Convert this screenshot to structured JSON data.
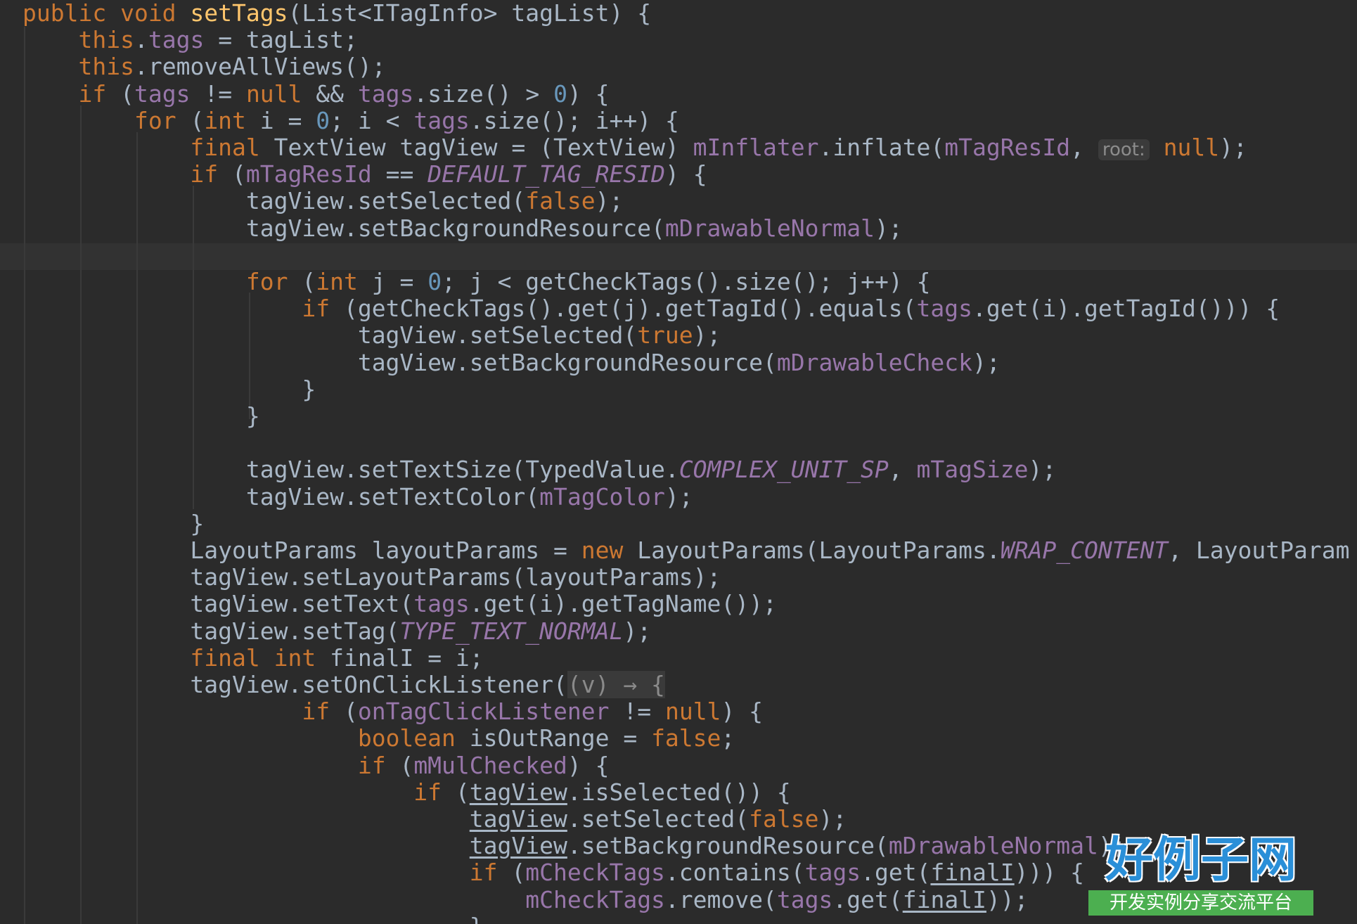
{
  "editor": {
    "lines": [
      [
        {
          "t": "public ",
          "c": "kw"
        },
        {
          "t": "void ",
          "c": "kw"
        },
        {
          "t": "setTags",
          "c": "mth"
        },
        {
          "t": "(List<ITagInfo> tagList) {"
        }
      ],
      [
        {
          "t": "    "
        },
        {
          "t": "this",
          "c": "kw"
        },
        {
          "t": "."
        },
        {
          "t": "tags",
          "c": "fld"
        },
        {
          "t": " = tagList;"
        }
      ],
      [
        {
          "t": "    "
        },
        {
          "t": "this",
          "c": "kw"
        },
        {
          "t": ".removeAllViews();"
        }
      ],
      [
        {
          "t": "    "
        },
        {
          "t": "if ",
          "c": "kw"
        },
        {
          "t": "("
        },
        {
          "t": "tags",
          "c": "fld"
        },
        {
          "t": " != "
        },
        {
          "t": "null ",
          "c": "kw"
        },
        {
          "t": "&& "
        },
        {
          "t": "tags",
          "c": "fld"
        },
        {
          "t": ".size() > "
        },
        {
          "t": "0",
          "c": "num"
        },
        {
          "t": ") {"
        }
      ],
      [
        {
          "t": "        "
        },
        {
          "t": "for ",
          "c": "kw"
        },
        {
          "t": "("
        },
        {
          "t": "int ",
          "c": "kw"
        },
        {
          "t": "i = "
        },
        {
          "t": "0",
          "c": "num"
        },
        {
          "t": "; i < "
        },
        {
          "t": "tags",
          "c": "fld"
        },
        {
          "t": ".size(); i++) {"
        }
      ],
      [
        {
          "t": "            "
        },
        {
          "t": "final ",
          "c": "kw"
        },
        {
          "t": "TextView tagView = (TextView) "
        },
        {
          "t": "mInflater",
          "c": "fld"
        },
        {
          "t": ".inflate("
        },
        {
          "t": "mTagResId",
          "c": "fld"
        },
        {
          "t": ", "
        },
        {
          "t": "root:",
          "c": "hint"
        },
        {
          "t": " "
        },
        {
          "t": "null",
          "c": "kw"
        },
        {
          "t": ");"
        }
      ],
      [
        {
          "t": "            "
        },
        {
          "t": "if ",
          "c": "kw"
        },
        {
          "t": "("
        },
        {
          "t": "mTagResId",
          "c": "fld"
        },
        {
          "t": " == "
        },
        {
          "t": "DEFAULT_TAG_RESID",
          "c": "cst"
        },
        {
          "t": ") {"
        }
      ],
      [
        {
          "t": "                tagView.setSelected("
        },
        {
          "t": "false",
          "c": "kw"
        },
        {
          "t": ");"
        }
      ],
      [
        {
          "t": "                tagView.setBackgroundResource("
        },
        {
          "t": "mDrawableNormal",
          "c": "fld"
        },
        {
          "t": ");"
        }
      ],
      [],
      [
        {
          "t": "                "
        },
        {
          "t": "for ",
          "c": "kw"
        },
        {
          "t": "("
        },
        {
          "t": "int ",
          "c": "kw"
        },
        {
          "t": "j = "
        },
        {
          "t": "0",
          "c": "num"
        },
        {
          "t": "; j < getCheckTags().size(); j++) {"
        }
      ],
      [
        {
          "t": "                    "
        },
        {
          "t": "if ",
          "c": "kw"
        },
        {
          "t": "(getCheckTags().get(j).getTagId().equals("
        },
        {
          "t": "tags",
          "c": "fld"
        },
        {
          "t": ".get(i).getTagId())) {"
        }
      ],
      [
        {
          "t": "                        tagView.setSelected("
        },
        {
          "t": "true",
          "c": "kw"
        },
        {
          "t": ");"
        }
      ],
      [
        {
          "t": "                        tagView.setBackgroundResource("
        },
        {
          "t": "mDrawableCheck",
          "c": "fld"
        },
        {
          "t": ");"
        }
      ],
      [
        {
          "t": "                    }"
        }
      ],
      [
        {
          "t": "                }"
        }
      ],
      [],
      [
        {
          "t": "                tagView.setTextSize(TypedValue."
        },
        {
          "t": "COMPLEX_UNIT_SP",
          "c": "cst"
        },
        {
          "t": ", "
        },
        {
          "t": "mTagSize",
          "c": "fld"
        },
        {
          "t": ");"
        }
      ],
      [
        {
          "t": "                tagView.setTextColor("
        },
        {
          "t": "mTagColor",
          "c": "fld"
        },
        {
          "t": ");"
        }
      ],
      [
        {
          "t": "            }"
        }
      ],
      [
        {
          "t": "            LayoutParams layoutParams = "
        },
        {
          "t": "new ",
          "c": "kw"
        },
        {
          "t": "LayoutParams(LayoutParams."
        },
        {
          "t": "WRAP_CONTENT",
          "c": "cst"
        },
        {
          "t": ", LayoutParam"
        }
      ],
      [
        {
          "t": "            tagView.setLayoutParams(layoutParams);"
        }
      ],
      [
        {
          "t": "            tagView.setText("
        },
        {
          "t": "tags",
          "c": "fld"
        },
        {
          "t": ".get(i).getTagName());"
        }
      ],
      [
        {
          "t": "            tagView.setTag("
        },
        {
          "t": "TYPE_TEXT_NORMAL",
          "c": "cst"
        },
        {
          "t": ");"
        }
      ],
      [
        {
          "t": "            "
        },
        {
          "t": "final ",
          "c": "kw"
        },
        {
          "t": "int ",
          "c": "kw"
        },
        {
          "t": "finalI = i;"
        }
      ],
      [
        {
          "t": "            tagView.setOnClickListener("
        },
        {
          "t": "(v) → {",
          "c": "fold"
        }
      ],
      [
        {
          "t": "                    "
        },
        {
          "t": "if ",
          "c": "kw"
        },
        {
          "t": "("
        },
        {
          "t": "onTagClickListener",
          "c": "fld"
        },
        {
          "t": " != "
        },
        {
          "t": "null",
          "c": "kw"
        },
        {
          "t": ") {"
        }
      ],
      [
        {
          "t": "                        "
        },
        {
          "t": "boolean ",
          "c": "kw"
        },
        {
          "t": "isOutRange = "
        },
        {
          "t": "false",
          "c": "kw"
        },
        {
          "t": ";"
        }
      ],
      [
        {
          "t": "                        "
        },
        {
          "t": "if ",
          "c": "kw"
        },
        {
          "t": "("
        },
        {
          "t": "mMulChecked",
          "c": "fld"
        },
        {
          "t": ") {"
        }
      ],
      [
        {
          "t": "                            "
        },
        {
          "t": "if ",
          "c": "kw"
        },
        {
          "t": "("
        },
        {
          "t": "tagView",
          "c": "ul"
        },
        {
          "t": ".isSelected()) {"
        }
      ],
      [
        {
          "t": "                                "
        },
        {
          "t": "tagView",
          "c": "ul"
        },
        {
          "t": ".setSelected("
        },
        {
          "t": "false",
          "c": "kw"
        },
        {
          "t": ");"
        }
      ],
      [
        {
          "t": "                                "
        },
        {
          "t": "tagView",
          "c": "ul"
        },
        {
          "t": ".setBackgroundResource("
        },
        {
          "t": "mDrawableNormal",
          "c": "fld"
        },
        {
          "t": ");"
        }
      ],
      [
        {
          "t": "                                "
        },
        {
          "t": "if ",
          "c": "kw"
        },
        {
          "t": "("
        },
        {
          "t": "mCheckTags",
          "c": "fld"
        },
        {
          "t": ".contains("
        },
        {
          "t": "tags",
          "c": "fld"
        },
        {
          "t": ".get("
        },
        {
          "t": "finalI",
          "c": "ul"
        },
        {
          "t": "))) {"
        }
      ],
      [
        {
          "t": "                                    "
        },
        {
          "t": "mCheckTags",
          "c": "fld"
        },
        {
          "t": ".remove("
        },
        {
          "t": "tags",
          "c": "fld"
        },
        {
          "t": ".get("
        },
        {
          "t": "finalI",
          "c": "ul"
        },
        {
          "t": "));"
        }
      ],
      [
        {
          "t": "                                }"
        }
      ]
    ]
  },
  "watermark": {
    "title": "好例子网",
    "subtitle": "开发实例分享交流平台"
  },
  "colors": {
    "background": "#2b2b2b",
    "keyword": "#cc7832",
    "field": "#9876aa",
    "number": "#6897bb",
    "method": "#ffc66d",
    "default_text": "#a9b7c6"
  }
}
